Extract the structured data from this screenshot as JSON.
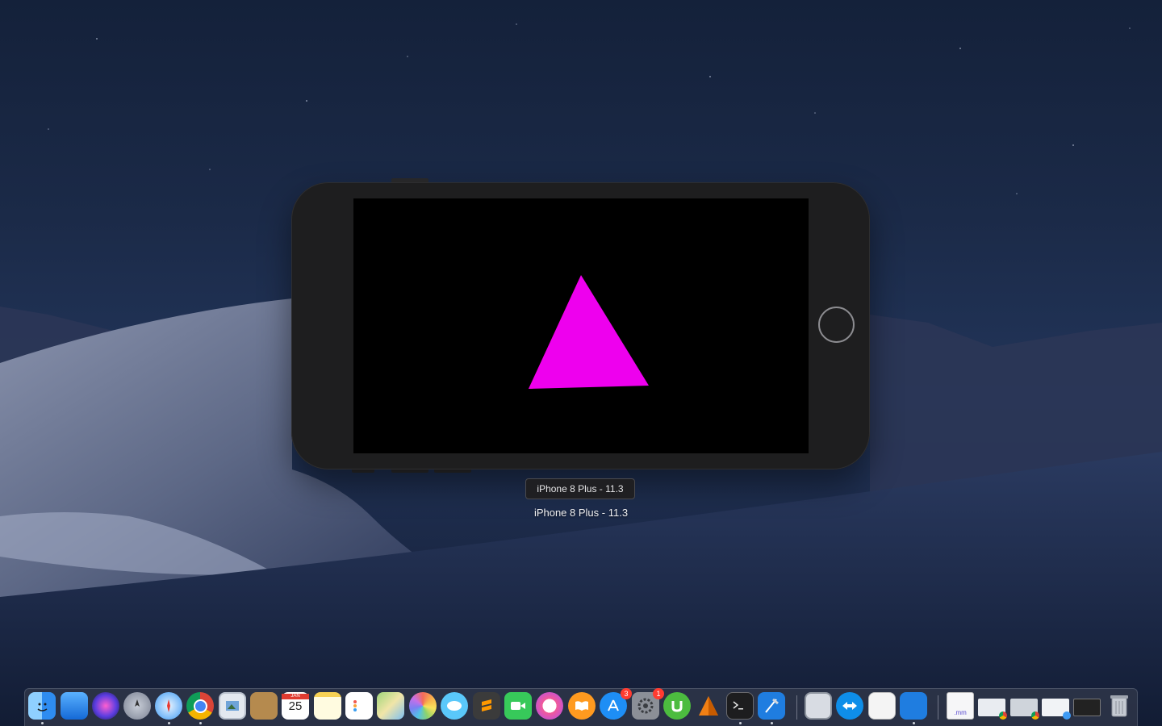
{
  "simulator": {
    "tooltip": "iPhone 8 Plus - 11.3",
    "window_title": "iPhone 8 Plus - 11.3"
  },
  "colors": {
    "pyramid_face": "#ee00ee",
    "pyramid_side": "#cc0033",
    "screen_bg": "#000000",
    "phone_body": "#1e1e1f"
  },
  "dock": {
    "calendar": {
      "month": "JAN",
      "day": "25"
    },
    "appstore_badge": "3",
    "prefs_badge": "1",
    "doc_ext": ".mm",
    "apps": [
      "finder-icon",
      "dashboard-icon",
      "siri-icon",
      "launchpad-icon",
      "safari-icon",
      "chrome-icon",
      "preview-icon",
      "notefile-icon",
      "calendar-icon",
      "notes-icon",
      "reminders-icon",
      "maps-icon",
      "photos-icon",
      "messages-icon",
      "sublime-icon",
      "facetime-icon",
      "itunes-icon",
      "ibooks-icon",
      "appstore-icon",
      "system-preferences-icon",
      "utorrent-icon",
      "vlc-icon",
      "terminal-icon",
      "xcode-icon",
      "image-capture-icon",
      "teamviewer-icon",
      "textedit-icon",
      "instruments-icon",
      "document-icon",
      "chrome-window-icon",
      "chrome-window-2-icon",
      "safari-window-icon",
      "terminal-window-icon",
      "trash-icon"
    ]
  }
}
